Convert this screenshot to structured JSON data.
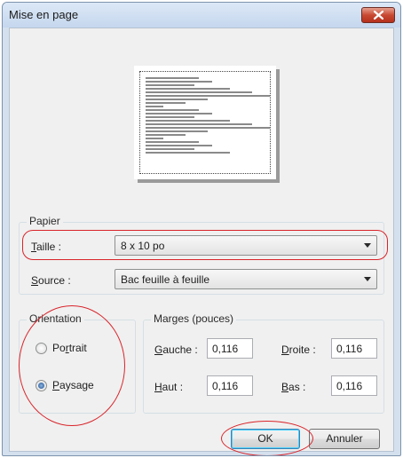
{
  "window": {
    "title": "Mise en page"
  },
  "paper": {
    "legend": "Papier",
    "size_label_hotkey": "T",
    "size_label_rest": "aille :",
    "size_value": "8 x 10 po",
    "source_label_hotkey": "S",
    "source_label_rest": "ource :",
    "source_value": "Bac feuille à feuille"
  },
  "orientation": {
    "legend": "Orientation",
    "portrait_pre": "Po",
    "portrait_hotkey": "r",
    "portrait_post": "trait",
    "landscape_hotkey": "P",
    "landscape_rest": "aysage",
    "selected": "landscape"
  },
  "margins": {
    "legend": "Marges (pouces)",
    "left_hotkey": "G",
    "left_rest": "auche :",
    "left_value": "0,116",
    "right_hotkey": "D",
    "right_rest": "roite :",
    "right_value": "0,116",
    "top_hotkey": "H",
    "top_rest": "aut :",
    "top_value": "0,116",
    "bottom_hotkey": "B",
    "bottom_rest": "as :",
    "bottom_value": "0,116"
  },
  "buttons": {
    "ok": "OK",
    "cancel": "Annuler"
  },
  "annotations": {
    "color": "#d9242a"
  },
  "colors": {
    "close_button": "#c84a33",
    "title_bar": "#c5d7ee",
    "dialog_bg": "#f0f0f0"
  }
}
